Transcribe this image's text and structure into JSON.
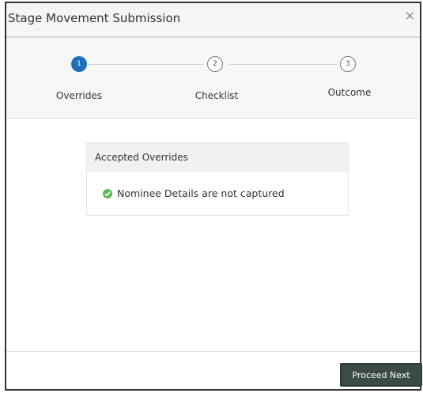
{
  "dialog": {
    "title": "Stage Movement Submission",
    "close_label": "×"
  },
  "stepper": {
    "steps": [
      {
        "number": "1",
        "label": "Overrides",
        "active": true
      },
      {
        "number": "2",
        "label": "Checklist",
        "active": false
      },
      {
        "number": "3",
        "label": "Outcome",
        "active": false
      }
    ]
  },
  "overrides": {
    "heading": "Accepted Overrides",
    "items": [
      {
        "text": "Nominee Details are not captured",
        "icon": "check-circle-icon",
        "color": "#5cb85c"
      }
    ]
  },
  "footer": {
    "proceed_label": "Proceed Next"
  },
  "colors": {
    "active_step": "#1a6fb8",
    "button_bg": "#3a4a47"
  }
}
